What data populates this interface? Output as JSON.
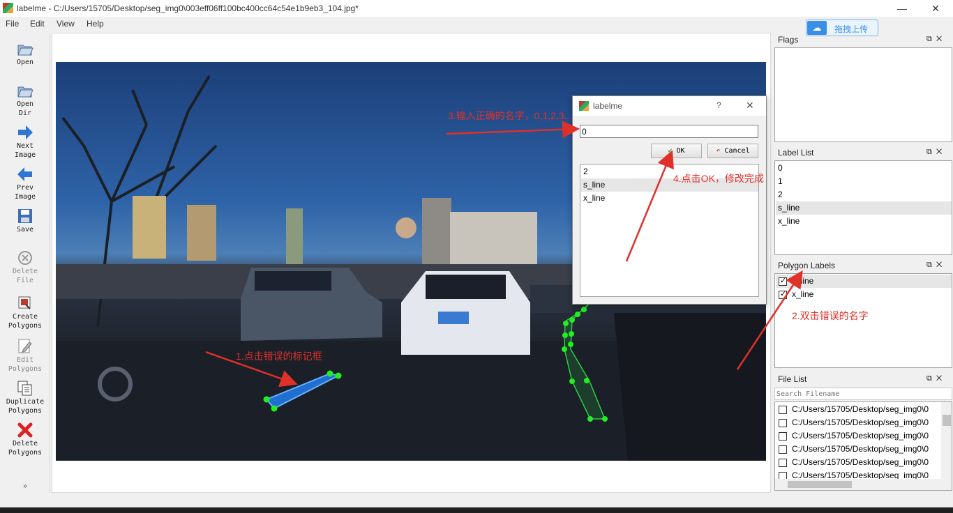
{
  "window": {
    "title": "labelme - C:/Users/15705/Desktop/seg_img0\\003eff06ff100bc400cc64c54e1b9eb3_104.jpg*"
  },
  "menu": [
    "File",
    "Edit",
    "View",
    "Help"
  ],
  "upload_widget": {
    "label": "拖拽上传"
  },
  "toolbar": [
    {
      "label": "Open",
      "icon": "folder-open-icon",
      "enabled": true
    },
    {
      "label": "Open\nDir",
      "icon": "folder-open-icon",
      "enabled": true
    },
    {
      "label": "Next\nImage",
      "icon": "arrow-right-icon",
      "enabled": true
    },
    {
      "label": "Prev\nImage",
      "icon": "arrow-left-icon",
      "enabled": true
    },
    {
      "label": "Save",
      "icon": "floppy-disk-icon",
      "enabled": true
    },
    {
      "label": "Delete\nFile",
      "icon": "delete-circle-icon",
      "enabled": false
    },
    {
      "label": "Create\nPolygons",
      "icon": "create-polygon-icon",
      "enabled": true
    },
    {
      "label": "Edit\nPolygons",
      "icon": "edit-polygon-icon",
      "enabled": false
    },
    {
      "label": "Duplicate\nPolygons",
      "icon": "duplicate-icon",
      "enabled": true
    },
    {
      "label": "Delete\nPolygons",
      "icon": "red-x-icon",
      "enabled": true
    }
  ],
  "docks": {
    "flags": {
      "title": "Flags"
    },
    "label_list": {
      "title": "Label List",
      "items": [
        "0",
        "1",
        "2",
        "s_line",
        "x_line"
      ],
      "selected": "s_line"
    },
    "polygon_labels": {
      "title": "Polygon Labels",
      "items": [
        {
          "label": "s_line",
          "checked": true
        },
        {
          "label": "x_line",
          "checked": true
        }
      ]
    },
    "file_list": {
      "title": "File List",
      "search_placeholder": "Search Filename",
      "files": [
        "C:/Users/15705/Desktop/seg_img0\\0",
        "C:/Users/15705/Desktop/seg_img0\\0",
        "C:/Users/15705/Desktop/seg_img0\\0",
        "C:/Users/15705/Desktop/seg_img0\\0",
        "C:/Users/15705/Desktop/seg_img0\\0",
        "C:/Users/15705/Desktop/seg_img0\\0"
      ]
    }
  },
  "dialog": {
    "title": "labelme",
    "help": "?",
    "input_value": "0",
    "ok_label": "OK",
    "cancel_label": "Cancel",
    "options": [
      "2",
      "s_line",
      "x_line"
    ],
    "selected": "s_line"
  },
  "annotations": {
    "step1": "1.点击错误的标记框",
    "step2": "2.双击错误的名字",
    "step3": "3.输入正确的名字，0,1,2,3...",
    "step4": "4.点击OK，修改完成"
  },
  "colors": {
    "annotation": "#e0302a",
    "selected_polygon": "#1f6fd1",
    "polygon": "#2ecc40",
    "vertex": "#22ee22"
  }
}
